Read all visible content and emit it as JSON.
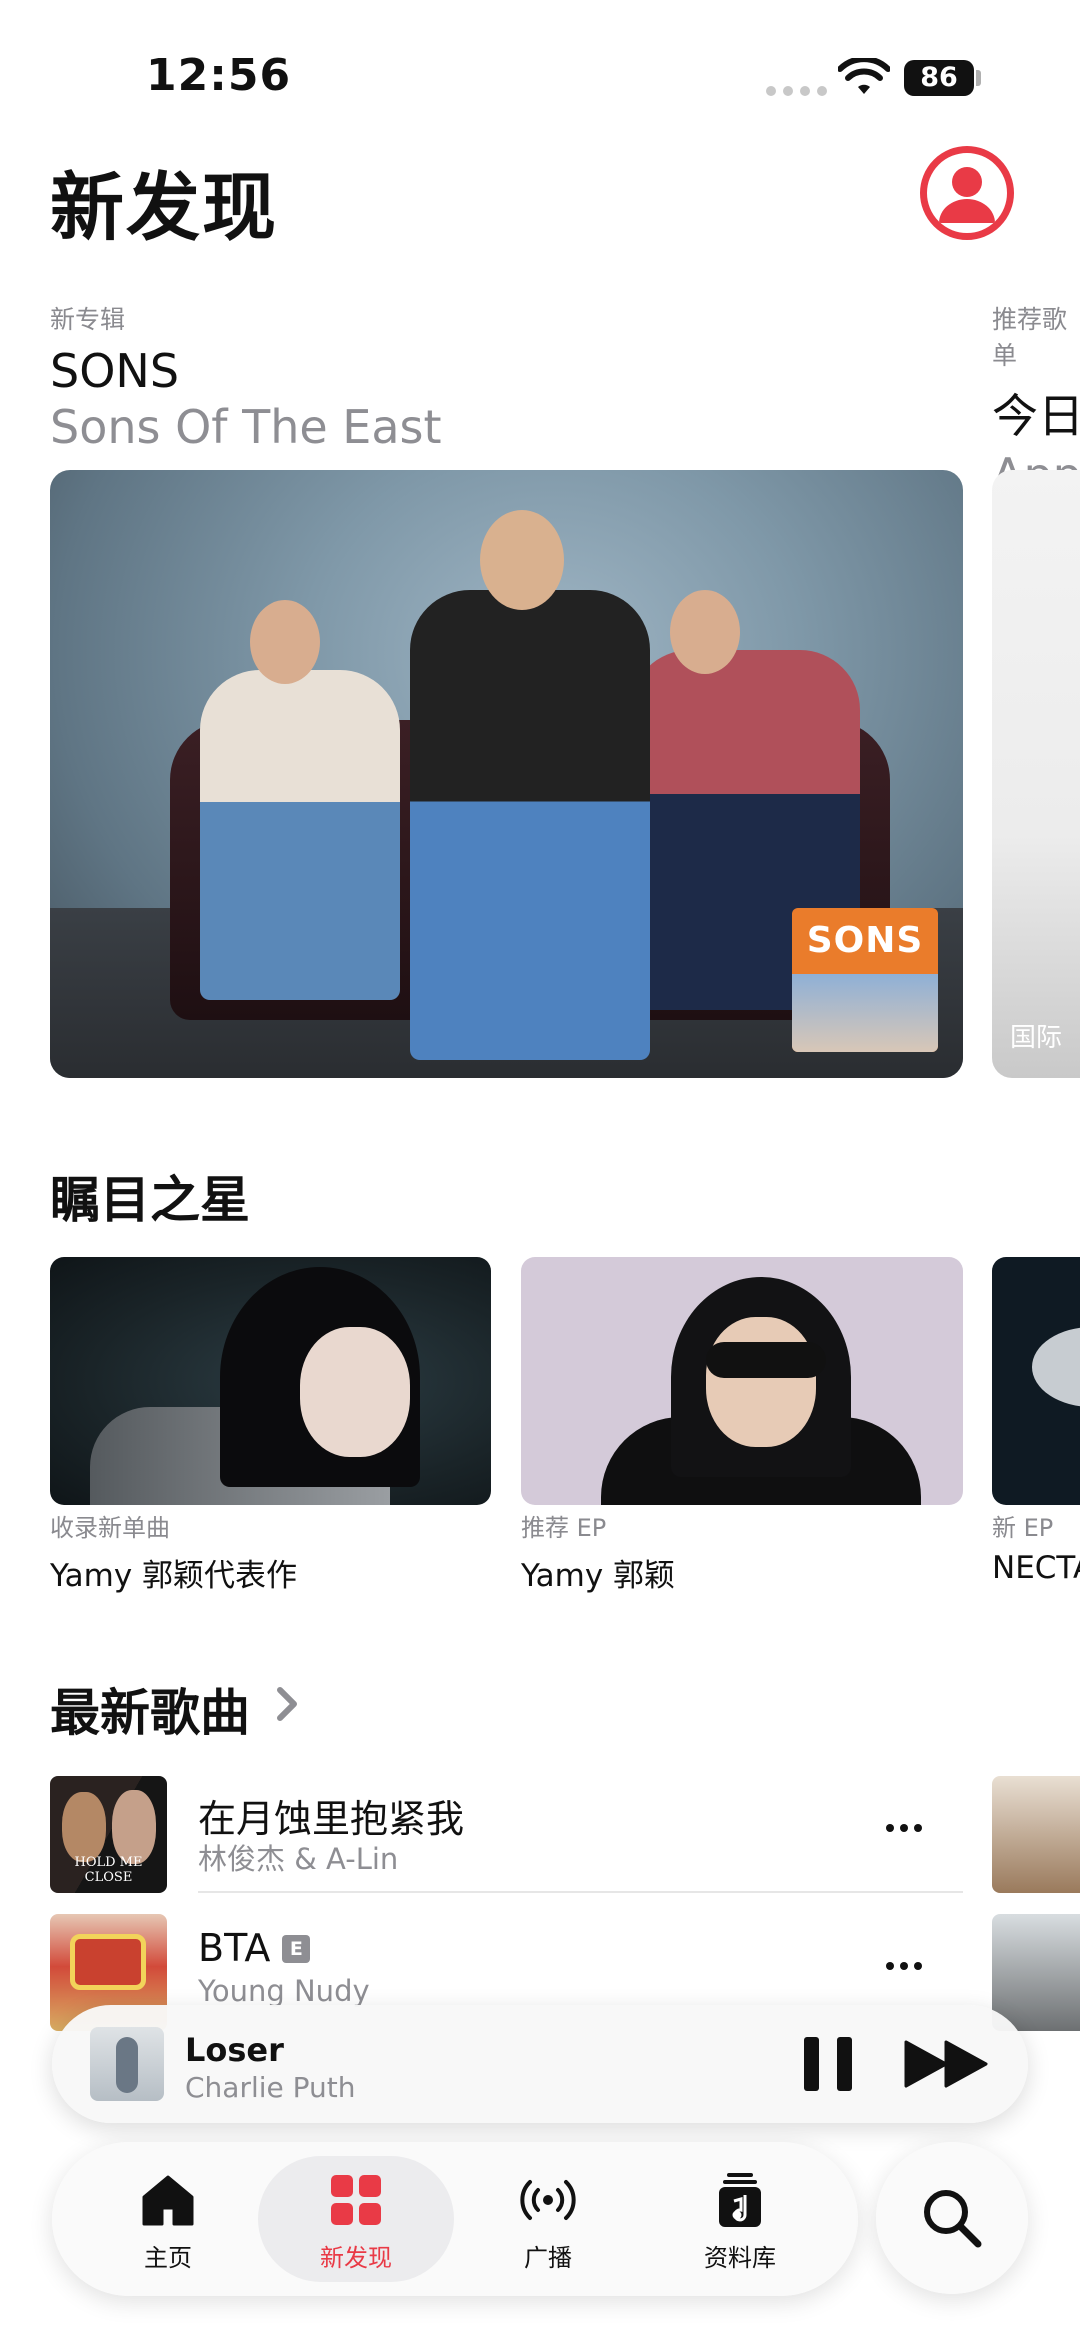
{
  "status": {
    "time": "12:56",
    "battery": "86"
  },
  "header": {
    "title": "新发现"
  },
  "featured": [
    {
      "kicker": "新专辑",
      "title": "SONS",
      "subtitle": "Sons Of The East",
      "cover_text": "SONS"
    },
    {
      "kicker": "推荐歌单",
      "title": "今日",
      "subtitle": "App",
      "cover_tag": "国际"
    }
  ],
  "rising": {
    "heading": "瞩目之星",
    "items": [
      {
        "kicker": "收录新单曲",
        "title": "Yamy 郭颖代表作"
      },
      {
        "kicker": "推荐 EP",
        "title": "Yamy 郭颖"
      },
      {
        "kicker": "新 EP",
        "title": "NECTA"
      }
    ]
  },
  "latest": {
    "heading": "最新歌曲",
    "songs": [
      {
        "title": "在月蚀里抱紧我",
        "artist": "林俊杰 & A-Lin",
        "art_text": "HOLD ME CLOSE",
        "explicit": false
      },
      {
        "title": "BTA",
        "artist": "Young Nudy",
        "explicit": true,
        "explicit_label": "E"
      }
    ]
  },
  "mini_player": {
    "title": "Loser",
    "artist": "Charlie Puth"
  },
  "tabs": [
    {
      "label": "主页",
      "icon": "home-icon",
      "active": false
    },
    {
      "label": "新发现",
      "icon": "grid-icon",
      "active": true
    },
    {
      "label": "广播",
      "icon": "radio-icon",
      "active": false
    },
    {
      "label": "资料库",
      "icon": "library-icon",
      "active": false
    }
  ],
  "colors": {
    "accent": "#e93a46",
    "secondary_text": "#8e8e93"
  }
}
